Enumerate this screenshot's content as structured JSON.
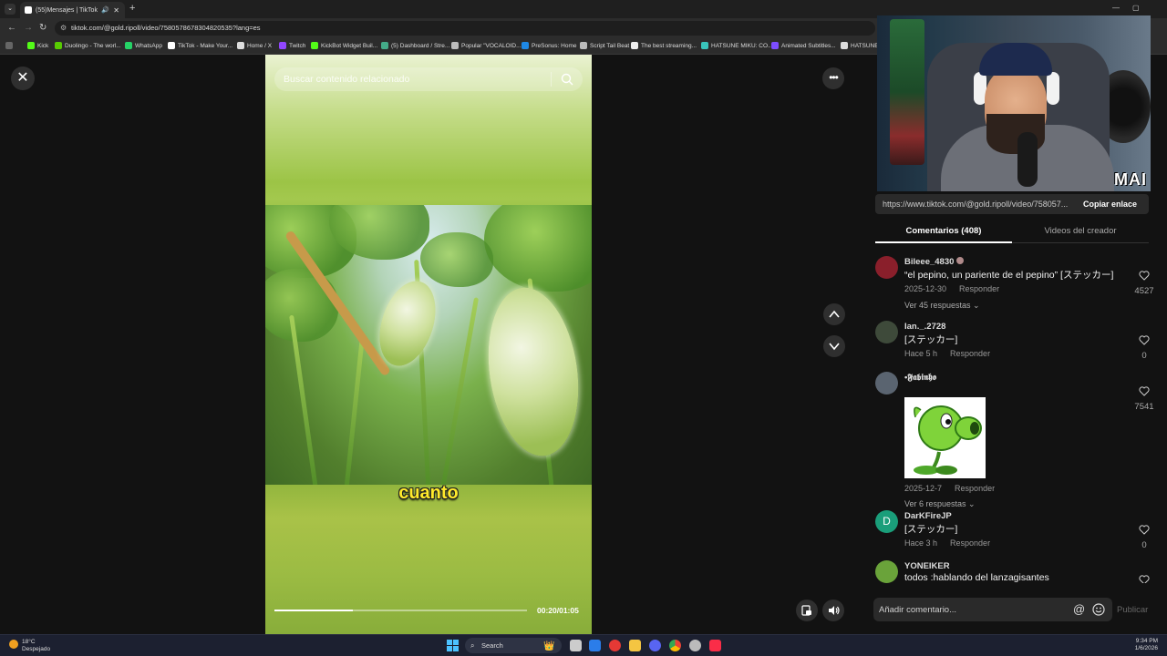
{
  "browser": {
    "tab_title": "(55)Mensajes | TikTok",
    "url": "tiktok.com/@gold.ripoll/video/7580578678304820535?lang=es",
    "bookmarks": [
      "Kick",
      "Duolingo - The worl...",
      "WhatsApp",
      "TikTok - Make Your...",
      "Home / X",
      "Twitch",
      "KickBot Widget Buil...",
      "(5) Dashboard / Stre...",
      "Popular \"VOCALOID...",
      "PreSonus: Home",
      "Script Tail Beat",
      "The best streaming...",
      "HATSUNE MIKU: CO...",
      "Animated Subtitles...",
      "HATSUNE I"
    ]
  },
  "video": {
    "search_placeholder": "Buscar contenido relacionado",
    "caption": "cuanto",
    "time": "00:20/01:05",
    "progress": 0.31
  },
  "webcam": {
    "logo": "MAI"
  },
  "panel": {
    "share_url": "https://www.tiktok.com/@gold.ripoll/video/758057...",
    "copy_label": "Copiar enlace",
    "tab_comments": "Comentarios (408)",
    "tab_creator": "Videos del creador",
    "comments": [
      {
        "user": "Bileee_4830",
        "text": "“el pepino, un pariente de el pepino” [ステッカー]",
        "date": "2025-12-30",
        "reply": "Responder",
        "likes": "4527",
        "more": "Ver 45 respuestas",
        "avatar_color": "#8a1f2b"
      },
      {
        "user": "Ian._.2728",
        "text": "[ステッカー]",
        "date": "Hace 5 h",
        "reply": "Responder",
        "likes": "0",
        "avatar_color": "#3e4a3a"
      },
      {
        "user": "•𝕱𝖆𝖇𝖎𝖓𝖍𝖔",
        "date": "2025-12-7",
        "reply": "Responder",
        "likes": "7541",
        "more": "Ver 6 respuestas",
        "avatar_color": "#5a6470"
      },
      {
        "user": "DarKFireJP",
        "avatar_letter": "D",
        "text": "[ステッカー]",
        "date": "Hace 3 h",
        "reply": "Responder",
        "likes": "0",
        "avatar_color": "#1a9e7a"
      },
      {
        "user": "YONEIKER",
        "text": "todos :hablando del lanzagisantes",
        "avatar_color": "#6aa33a"
      }
    ],
    "comment_placeholder": "Añadir comentario...",
    "publish_label": "Publicar"
  },
  "taskbar": {
    "temperature": "18°C",
    "weather": "Despejado",
    "search_label": "Search",
    "time": "9:34 PM",
    "date": "1/6/2026"
  }
}
